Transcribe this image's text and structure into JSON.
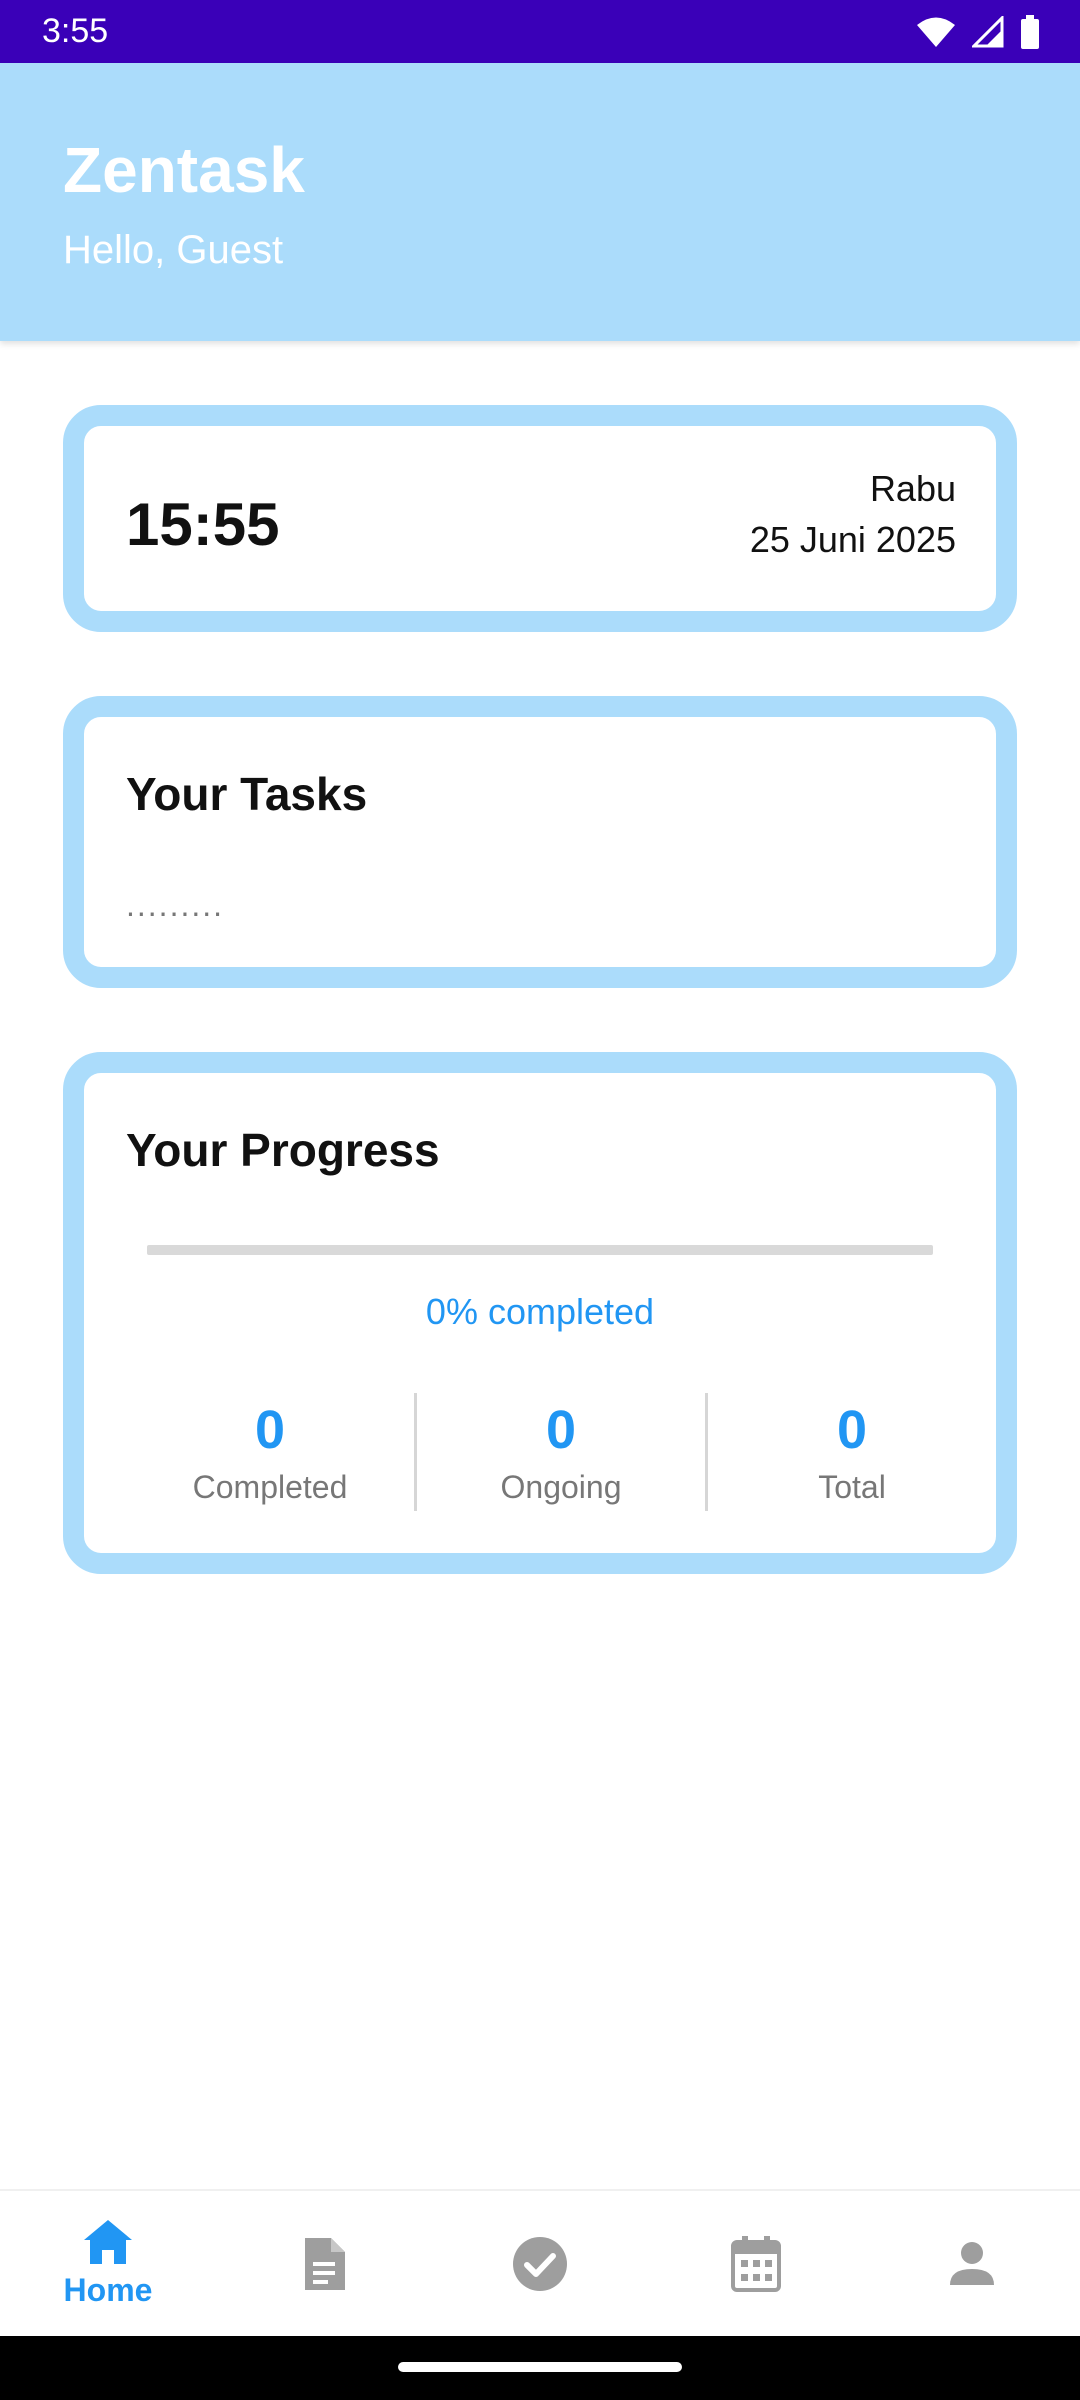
{
  "status_bar": {
    "time": "3:55",
    "icons": [
      "wifi-icon",
      "signal-icon",
      "battery-icon"
    ]
  },
  "header": {
    "title": "Zentask",
    "greeting": "Hello, Guest"
  },
  "clock_card": {
    "time": "15:55",
    "day": "Rabu",
    "date": "25 Juni 2025"
  },
  "tasks_card": {
    "title": "Your Tasks",
    "placeholder": "........."
  },
  "progress_card": {
    "title": "Your Progress",
    "progress_percent": 0,
    "progress_text": "0% completed",
    "stats": [
      {
        "value": "0",
        "label": "Completed"
      },
      {
        "value": "0",
        "label": "Ongoing"
      },
      {
        "value": "0",
        "label": "Total"
      }
    ]
  },
  "bottom_nav": {
    "items": [
      {
        "icon": "home-icon",
        "label": "Home",
        "active": true
      },
      {
        "icon": "document-icon",
        "label": "",
        "active": false
      },
      {
        "icon": "check-circle-icon",
        "label": "",
        "active": false
      },
      {
        "icon": "calendar-icon",
        "label": "",
        "active": false
      },
      {
        "icon": "person-icon",
        "label": "",
        "active": false
      }
    ]
  },
  "colors": {
    "status_bar": "#3a00b8",
    "header": "#abdcfb",
    "accent": "#2196f3",
    "inactive_icon": "#9e9e9e"
  }
}
